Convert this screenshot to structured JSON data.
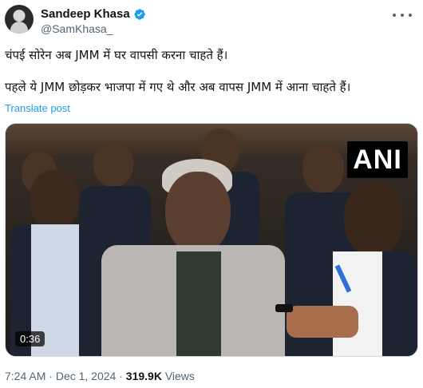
{
  "author": {
    "display_name": "Sandeep Khasa",
    "handle": "@SamKhasa_",
    "verified": true,
    "avatar_icon": "profile-photo"
  },
  "tweet": {
    "line1": "चंपई सोरेन अब JMM में घर वापसी करना चाहते हैं।",
    "line2": "पहले ये JMM छोड़कर भाजपा में गए थे और अब वापस JMM में आना चाहते हैं।",
    "translate_label": "Translate post"
  },
  "media": {
    "type": "video",
    "watermark": "ANI",
    "duration": "0:36"
  },
  "meta": {
    "time": "7:24 AM",
    "separator": "·",
    "date": "Dec 1, 2024",
    "views_count": "319.9K",
    "views_label": "Views"
  },
  "colors": {
    "link": "#1d9bf0",
    "verified": "#1d9bf0",
    "secondary_text": "#536471"
  }
}
